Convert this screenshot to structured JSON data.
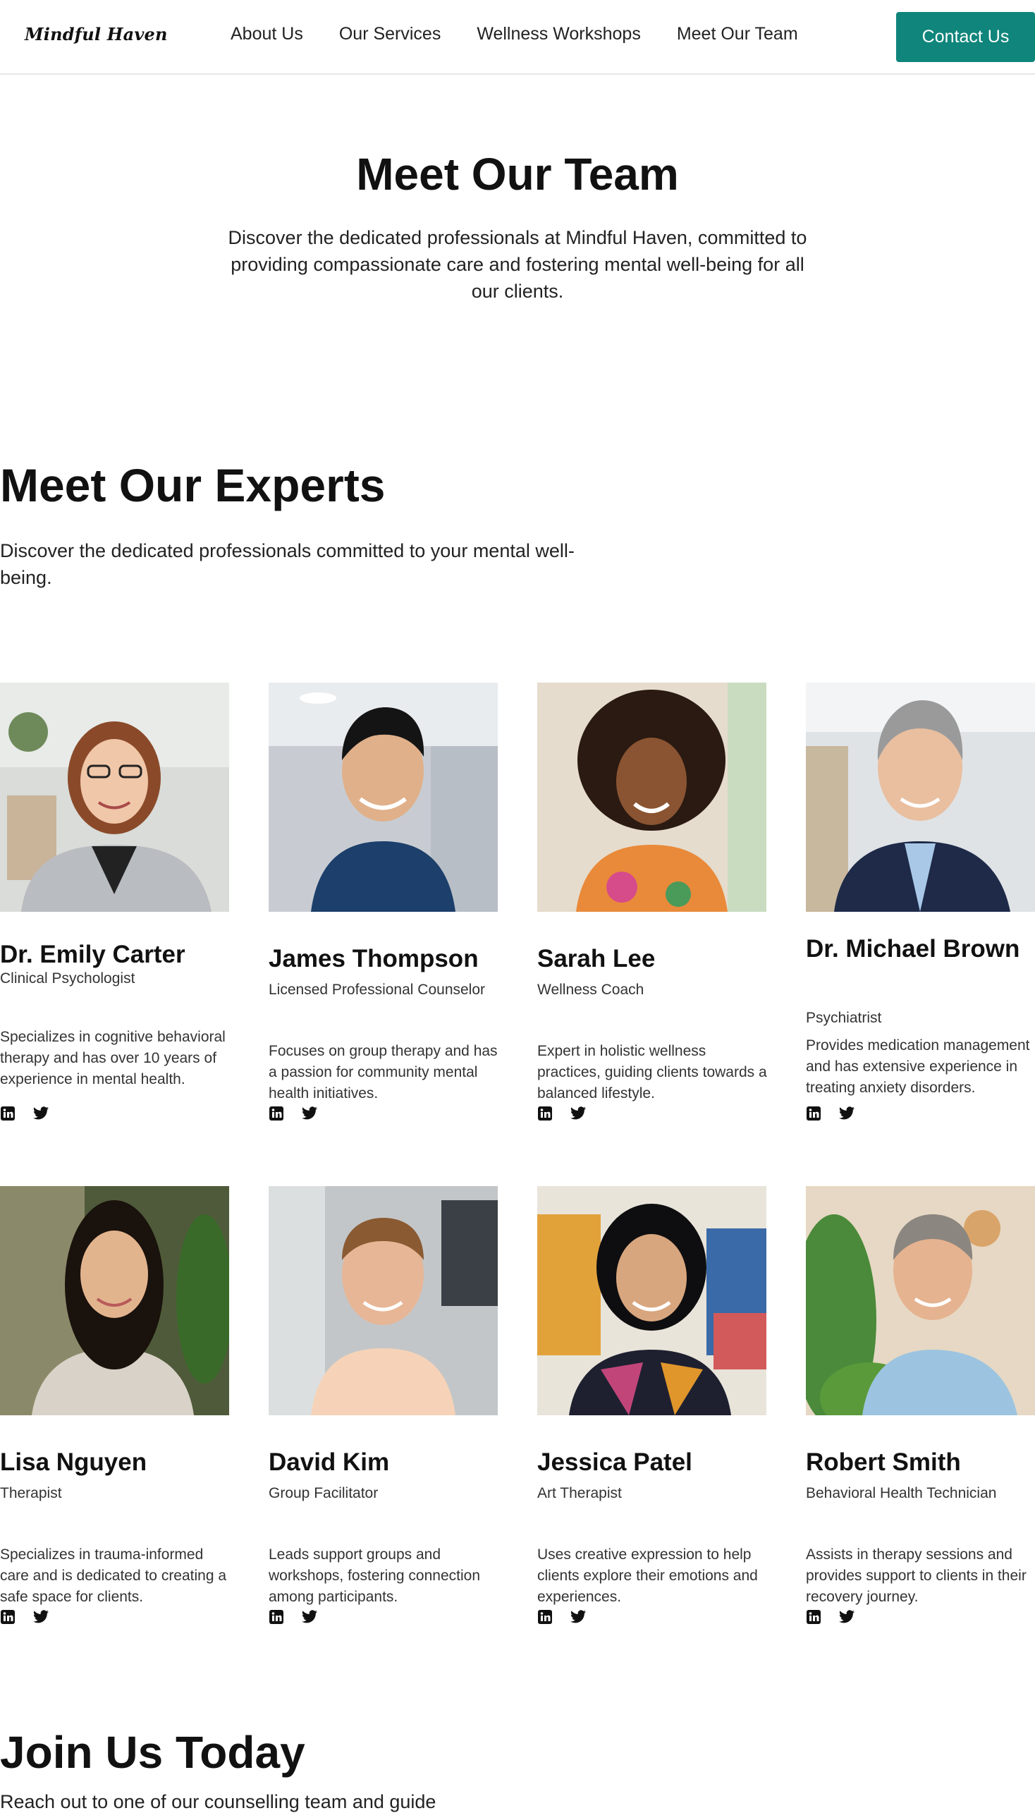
{
  "brand": "Mindful Haven",
  "nav": {
    "links": [
      "About Us",
      "Our Services",
      "Wellness Workshops",
      "Meet Our Team"
    ],
    "cta": "Contact Us"
  },
  "hero": {
    "title": "Meet Our Team",
    "description": "Discover the dedicated professionals at Mindful Haven, committed to providing compassionate care and fostering mental well-being for all our clients."
  },
  "experts": {
    "title": "Meet Our Experts",
    "description": "Discover the dedicated professionals committed to your mental well-being."
  },
  "team": [
    {
      "name": "Dr. Emily Carter",
      "role": "Clinical Psychologist",
      "bio": "Specializes in cognitive behavioral therapy and has over 10 years of experience in mental health."
    },
    {
      "name": "James Thompson",
      "role": "Licensed Professional Counselor",
      "bio": "Focuses on group therapy and has a passion for community mental health initiatives."
    },
    {
      "name": "Sarah Lee",
      "role": "Wellness Coach",
      "bio": "Expert in holistic wellness practices, guiding clients towards a balanced lifestyle."
    },
    {
      "name": "Dr. Michael Brown",
      "role": "Psychiatrist",
      "bio": "Provides medication management and has extensive experience in treating anxiety disorders."
    },
    {
      "name": "Lisa Nguyen",
      "role": "Therapist",
      "bio": "Specializes in trauma-informed care and is dedicated to creating a safe space for clients."
    },
    {
      "name": "David Kim",
      "role": "Group Facilitator",
      "bio": "Leads support groups and workshops, fostering connection among participants."
    },
    {
      "name": "Jessica Patel",
      "role": "Art Therapist",
      "bio": "Uses creative expression to help clients explore their emotions and experiences."
    },
    {
      "name": "Robert Smith",
      "role": "Behavioral Health Technician",
      "bio": "Assists in therapy sessions and provides support to clients in their recovery journey."
    }
  ],
  "social_icons": [
    "linkedin-icon",
    "twitter-icon"
  ],
  "join": {
    "title": "Join Us Today",
    "description": "Reach out to one of our counselling team and guide"
  },
  "colors": {
    "accent": "#0f857b",
    "text": "#111111",
    "muted": "#333333"
  }
}
